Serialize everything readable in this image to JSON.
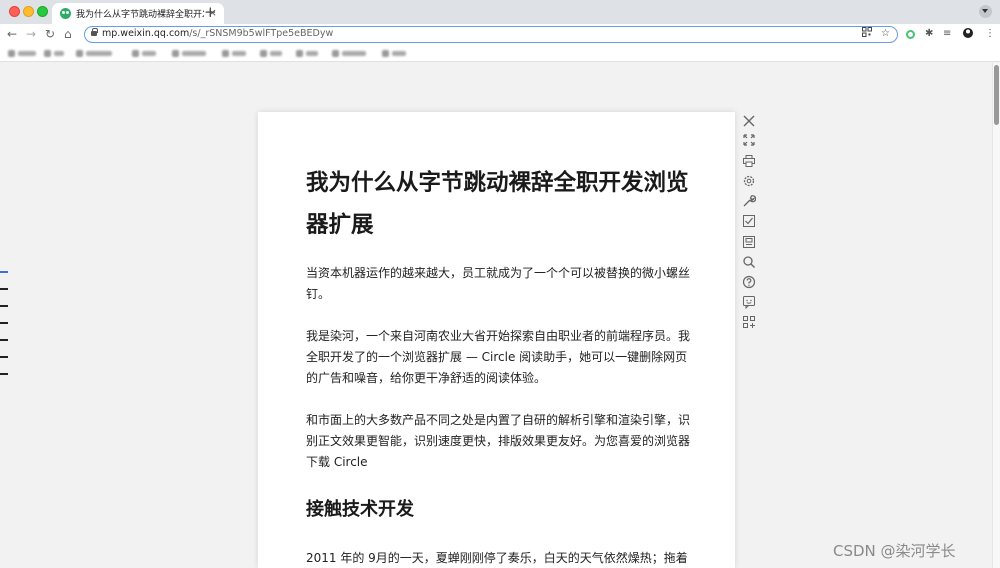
{
  "browser": {
    "tab": {
      "title": "我为什么从字节跳动裸辞全职开发浏览器扩展",
      "close": "×"
    },
    "new_tab": "+",
    "nav": {
      "back": "←",
      "forward": "→",
      "reload": "↻",
      "home": "⌂"
    },
    "url": {
      "host": "mp.weixin.qq.com",
      "path": "/s/_rSNSM9b5wlFTpe5eBEDyw"
    },
    "omnibox_icons": [
      "qr-code-icon",
      "star-icon"
    ],
    "extensions": [
      "circle-extension-icon",
      "puzzle-icon",
      "reading-list-icon",
      "profile-icon",
      "kebab-menu-icon"
    ],
    "kebab": "⋮"
  },
  "article": {
    "title": "我为什么从字节跳动裸辞全职开发浏览器扩展",
    "paragraphs": [
      "当资本机器运作的越来越大，员工就成为了一个个可以被替换的微小螺丝钉。",
      "我是染河，一个来自河南农业大省开始探索自由职业者的前端程序员。我全职开发了的一个浏览器扩展 — Circle 阅读助手，她可以一键删除网页的广告和噪音，给你更干净舒适的阅读体验。",
      "和市面上的大多数产品不同之处是内置了自研的解析引擎和渲染引擎，识别正文效果更智能，识别速度更快，排版效果更友好。为您喜爱的浏览器下载 Circle"
    ],
    "section_heading": "接触技术开发",
    "section_paragraph": "2011 年的 9月的一天，夏蝉刚刚停了奏乐，白天的天气依然燥热；拖着"
  },
  "reader_tools": [
    "close-icon",
    "fullscreen-icon",
    "print-icon",
    "settings-icon",
    "wrench-icon",
    "checklist-icon",
    "save-icon",
    "search-icon",
    "help-icon",
    "feedback-icon",
    "apps-icon"
  ],
  "watermark": "CSDN @染河学长",
  "colors": {
    "accent": "#3b6fe0",
    "omnibox_border": "#6a9be8",
    "wechat_green": "#2aae67"
  }
}
